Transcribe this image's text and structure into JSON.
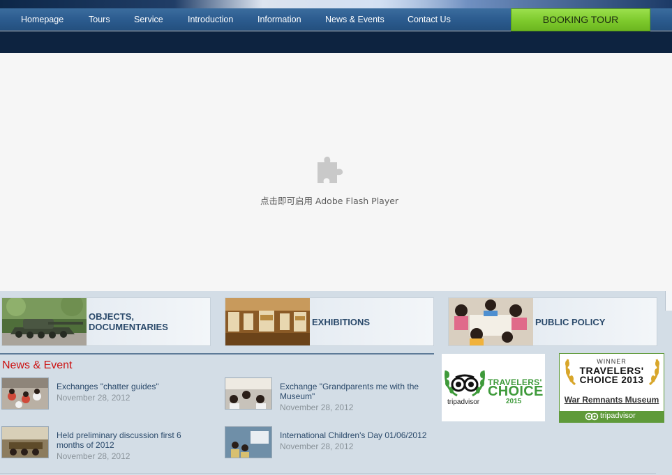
{
  "nav": {
    "items": [
      {
        "label": "Homepage"
      },
      {
        "label": "Tours"
      },
      {
        "label": "Service"
      },
      {
        "label": "Introduction"
      },
      {
        "label": "Information"
      },
      {
        "label": "News & Events"
      },
      {
        "label": "Contact Us"
      }
    ],
    "booking_label": "BOOKING TOUR"
  },
  "flash": {
    "icon": "puzzle-plugin-icon",
    "message": "点击即可启用 Adobe Flash Player"
  },
  "categories": [
    {
      "label_line1": "OBJECTS,",
      "label_line2": "DOCUMENTARIES",
      "image": "tank-photo"
    },
    {
      "label_line1": "EXHIBITIONS",
      "label_line2": "",
      "image": "exhibition-hall-photo"
    },
    {
      "label_line1": "PUBLIC POLICY",
      "label_line2": "",
      "image": "children-drawing-photo"
    }
  ],
  "news": {
    "title": "News & Event",
    "items": [
      {
        "headline": "Exchanges \"chatter guides\"",
        "date": "November 28, 2012"
      },
      {
        "headline": "Exchange \"Grandparents me with the Museum\"",
        "date": "November 28, 2012"
      },
      {
        "headline": "Held preliminary discussion first 6 months of 2012",
        "date": "November 28, 2012"
      },
      {
        "headline": "International Children's Day 01/06/2012",
        "date": "November 28, 2012"
      }
    ]
  },
  "awards": {
    "award1": {
      "line1": "TRAVELERS'",
      "line2": "CHOICE",
      "year": "2015",
      "brand": "tripadvisor"
    },
    "award2": {
      "winner": "WINNER",
      "line1": "TRAVELERS'",
      "line2": "CHOICE 2013",
      "name": "War Remnants Museum",
      "brand": "tripadvisor"
    }
  },
  "colors": {
    "nav_bg": "#2c5c8f",
    "booking_bg": "#7dc92c",
    "news_title": "#cc1111",
    "tripadvisor_green": "#3e9a3a",
    "page_bg": "#d3dde6"
  }
}
